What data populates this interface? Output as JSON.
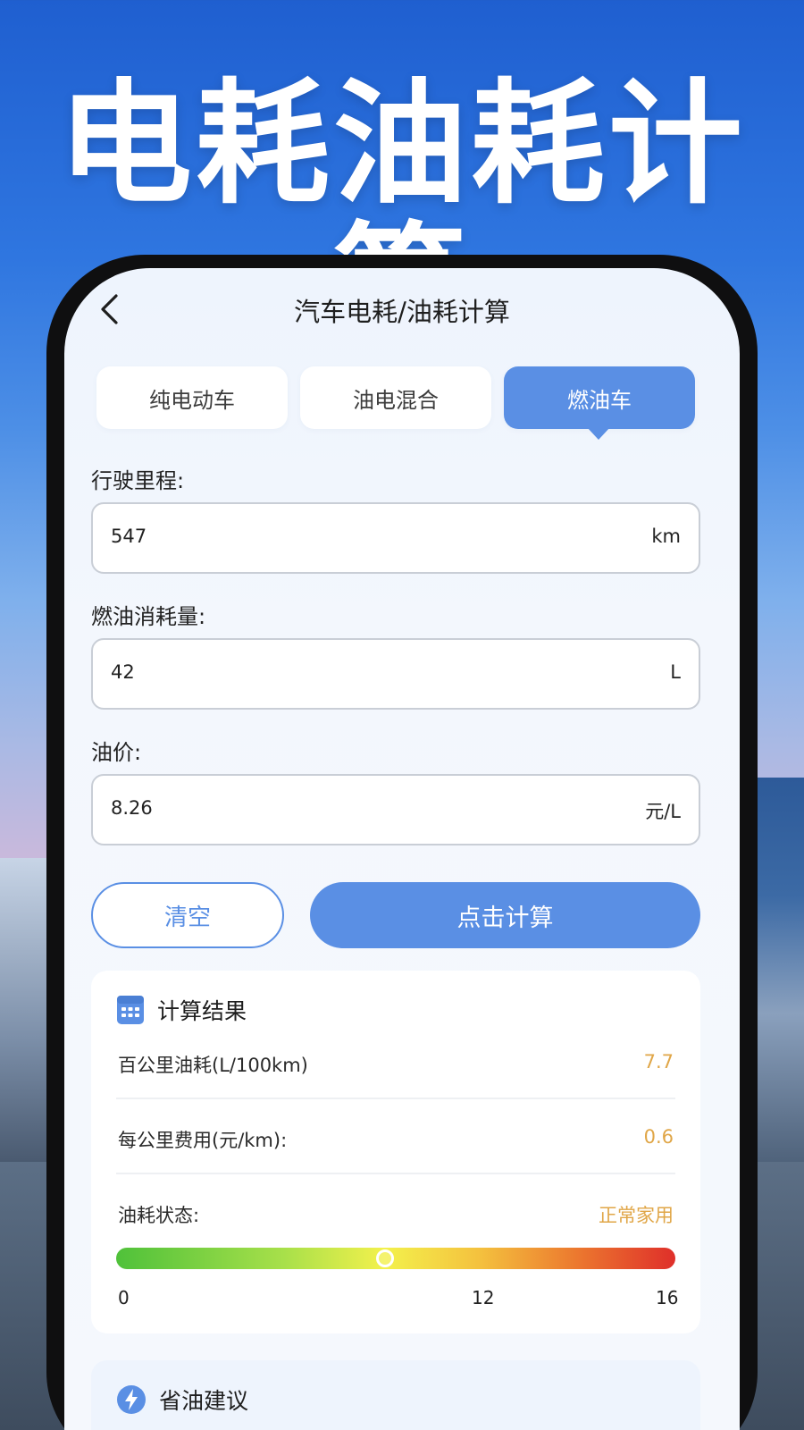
{
  "hero": {
    "title": "电耗油耗计算"
  },
  "nav": {
    "back_icon": "chevron-left-icon",
    "title": "汽车电耗/油耗计算"
  },
  "tabs": [
    {
      "label": "纯电动车",
      "active": false
    },
    {
      "label": "油电混合",
      "active": false
    },
    {
      "label": "燃油车",
      "active": true
    }
  ],
  "form": {
    "mileage": {
      "label": "行驶里程:",
      "value": "547",
      "unit": "km"
    },
    "fuel": {
      "label": "燃油消耗量:",
      "value": "42",
      "unit": "L"
    },
    "price": {
      "label": "油价:",
      "value": "8.26",
      "unit": "元/L"
    }
  },
  "actions": {
    "clear_label": "清空",
    "calc_label": "点击计算"
  },
  "result": {
    "icon": "calculator-icon",
    "title": "计算结果",
    "rows": [
      {
        "label": "百公里油耗(L/100km)",
        "value": "7.7"
      },
      {
        "label": "每公里费用(元/km):",
        "value": "0.6"
      },
      {
        "label": "油耗状态:",
        "value": "正常家用"
      }
    ],
    "gauge": {
      "min": 0,
      "max": 16,
      "value": 7.7,
      "ticks": [
        "0",
        "12",
        "16"
      ]
    }
  },
  "tip": {
    "icon": "lightning-icon",
    "title": "省油建议"
  },
  "colors": {
    "accent": "#5a8fe4",
    "value": "#e0a647"
  }
}
